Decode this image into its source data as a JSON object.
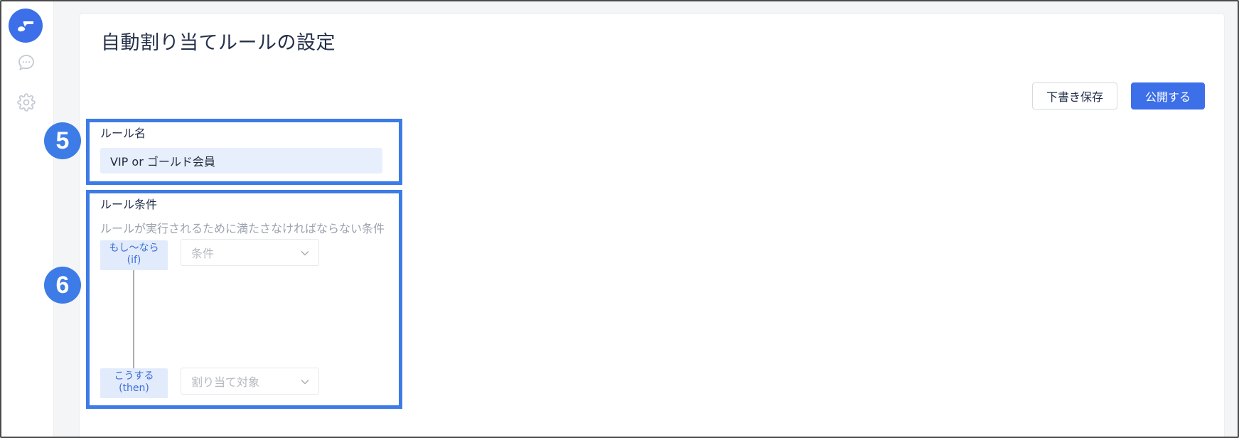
{
  "page": {
    "title": "自動割り当てルールの設定"
  },
  "toolbar": {
    "draft_label": "下書き保存",
    "publish_label": "公開する"
  },
  "sidebar": {
    "icons": [
      "logo-icon",
      "chat-icon",
      "gear-icon"
    ]
  },
  "rule_name": {
    "badge": "5",
    "label": "ルール名",
    "value": "VIP or ゴールド会員"
  },
  "rule_conditions": {
    "badge": "6",
    "label": "ルール条件",
    "hint": "ルールが実行されるために満たさなければならない条件",
    "if_tag_line1": "もし〜なら",
    "if_tag_line2": "(if)",
    "if_select_placeholder": "条件",
    "then_tag_line1": "こうする",
    "then_tag_line2": "(then)",
    "then_select_placeholder": "割り当て対象"
  },
  "colors": {
    "accent": "#3c6fe8",
    "highlight": "#3d7be6",
    "input_bg": "#e7effd",
    "tag_bg": "#e1ebfc"
  }
}
